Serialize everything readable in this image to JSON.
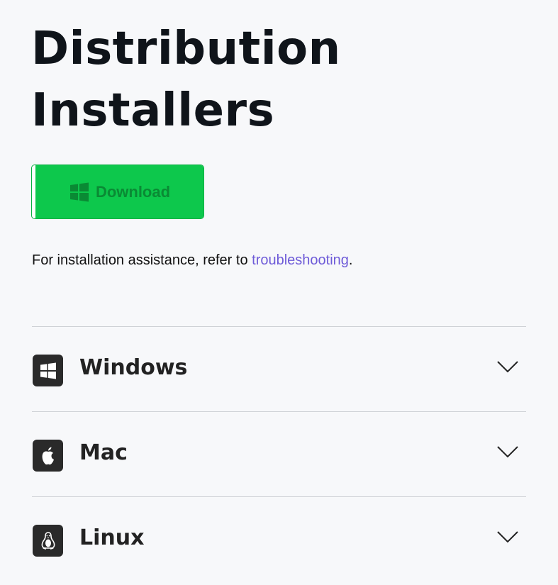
{
  "header": {
    "title_line1": "Distribution",
    "title_line2": "Installers"
  },
  "download": {
    "label": "Download",
    "icon": "windows-icon",
    "colors": {
      "background": "#0dc84c",
      "text": "#0a8a34"
    }
  },
  "assist": {
    "text": "For installation assistance, refer to ",
    "link_label": "troubleshooting",
    "suffix": ".",
    "link_color": "#6e5bd8"
  },
  "platforms": [
    {
      "label": "Windows",
      "icon": "windows-icon",
      "expand_icon": "chevron-down-icon"
    },
    {
      "label": "Mac",
      "icon": "apple-icon",
      "expand_icon": "chevron-down-icon"
    },
    {
      "label": "Linux",
      "icon": "linux-penguin-icon",
      "expand_icon": "chevron-down-icon"
    }
  ]
}
